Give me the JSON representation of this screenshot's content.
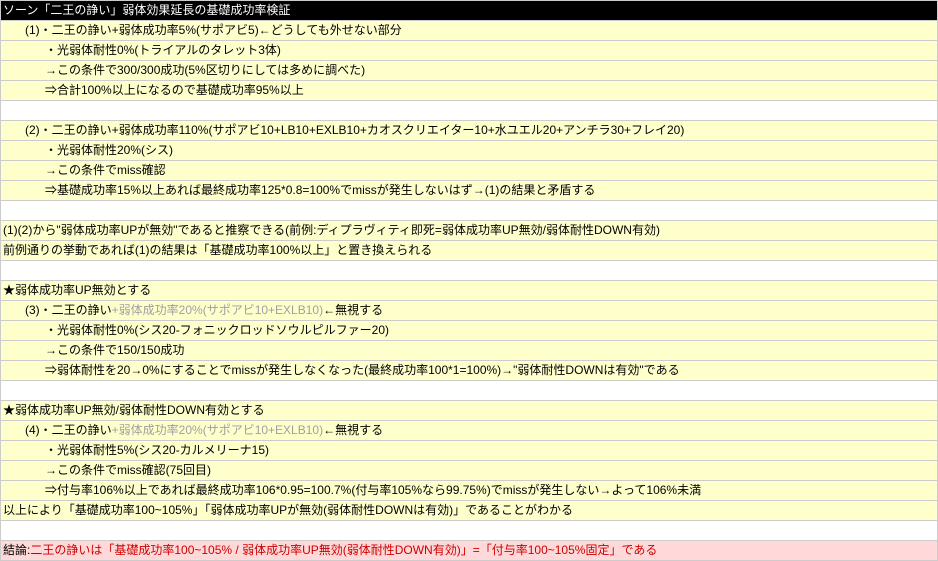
{
  "title": "ソーン「二王の諍い」弱体効果延長の基礎成功率検証",
  "rows": [
    {
      "cls": "yellow-row",
      "ind": "ind1",
      "parts": [
        [
          "(1)・二王の諍い+弱体成功率5%(サポアビ5)←どうしても外せない部分",
          ""
        ]
      ]
    },
    {
      "cls": "yellow-row",
      "ind": "ind2",
      "parts": [
        [
          "・光弱体耐性0%(トライアルのタレット3体)",
          ""
        ]
      ]
    },
    {
      "cls": "yellow-row",
      "ind": "ind2",
      "parts": [
        [
          "→この条件で300/300成功(5%区切りにしては多めに調べた)",
          ""
        ]
      ]
    },
    {
      "cls": "yellow-row",
      "ind": "ind2",
      "parts": [
        [
          "⇒合計100%以上になるので基礎成功率95%以上",
          ""
        ]
      ]
    },
    {
      "cls": "white-row",
      "ind": "",
      "parts": [
        [
          "",
          ""
        ]
      ]
    },
    {
      "cls": "yellow-row",
      "ind": "ind1",
      "parts": [
        [
          "(2)・二王の諍い+弱体成功率110%(サポアビ10+LB10+EXLB10+カオスクリエイター10+水ユエル20+アンチラ30+フレイ20)",
          ""
        ]
      ]
    },
    {
      "cls": "yellow-row",
      "ind": "ind2",
      "parts": [
        [
          "・光弱体耐性20%(シス)",
          ""
        ]
      ]
    },
    {
      "cls": "yellow-row",
      "ind": "ind2",
      "parts": [
        [
          "→この条件でmiss確認",
          ""
        ]
      ]
    },
    {
      "cls": "yellow-row",
      "ind": "ind2",
      "parts": [
        [
          "⇒基礎成功率15%以上あれば最終成功率125*0.8=100%でmissが発生しないはず→(1)の結果と矛盾する",
          ""
        ]
      ]
    },
    {
      "cls": "white-row",
      "ind": "",
      "parts": [
        [
          "",
          ""
        ]
      ]
    },
    {
      "cls": "yellow-row",
      "ind": "",
      "parts": [
        [
          "(1)(2)から\"弱体成功率UPが無効\"であると推察できる(前例:ディプラヴィティ即死=弱体成功率UP無効/弱体耐性DOWN有効)",
          ""
        ]
      ]
    },
    {
      "cls": "yellow-row",
      "ind": "",
      "parts": [
        [
          "前例通りの挙動であれば(1)の結果は「基礎成功率100%以上」と置き換えられる",
          ""
        ]
      ]
    },
    {
      "cls": "white-row",
      "ind": "",
      "parts": [
        [
          "",
          ""
        ]
      ]
    },
    {
      "cls": "yellow-row",
      "ind": "",
      "parts": [
        [
          "★弱体成功率UP無効とする",
          ""
        ]
      ]
    },
    {
      "cls": "yellow-row",
      "ind": "ind1",
      "parts": [
        [
          "(3)・二王の諍い",
          ""
        ],
        [
          "+弱体成功率20%(サポアビ10+EXLB10)",
          "gray"
        ],
        [
          "←無視する",
          ""
        ]
      ]
    },
    {
      "cls": "yellow-row",
      "ind": "ind2",
      "parts": [
        [
          "・光弱体耐性0%(シス20-フォニックロッドソウルピルファー20)",
          ""
        ]
      ]
    },
    {
      "cls": "yellow-row",
      "ind": "ind2",
      "parts": [
        [
          "→この条件で150/150成功",
          ""
        ]
      ]
    },
    {
      "cls": "yellow-row",
      "ind": "ind2",
      "parts": [
        [
          "⇒弱体耐性を20→0%にすることでmissが発生しなくなった(最終成功率100*1=100%)→\"弱体耐性DOWNは有効\"である",
          ""
        ]
      ]
    },
    {
      "cls": "white-row",
      "ind": "",
      "parts": [
        [
          "",
          ""
        ]
      ]
    },
    {
      "cls": "yellow-row",
      "ind": "",
      "parts": [
        [
          "★弱体成功率UP無効/弱体耐性DOWN有効とする",
          ""
        ]
      ]
    },
    {
      "cls": "yellow-row",
      "ind": "ind1",
      "parts": [
        [
          "(4)・二王の諍い",
          ""
        ],
        [
          "+弱体成功率20%(サポアビ10+EXLB10)",
          "gray"
        ],
        [
          "←無視する",
          ""
        ]
      ]
    },
    {
      "cls": "yellow-row",
      "ind": "ind2",
      "parts": [
        [
          "・光弱体耐性5%(シス20-カルメリーナ15)",
          ""
        ]
      ]
    },
    {
      "cls": "yellow-row",
      "ind": "ind2",
      "parts": [
        [
          "→この条件でmiss確認(75回目)",
          ""
        ]
      ]
    },
    {
      "cls": "yellow-row",
      "ind": "ind2",
      "parts": [
        [
          "⇒付与率106%以上であれば最終成功率106*0.95=100.7%(付与率105%なら99.75%)でmissが発生しない→よって106%未満",
          ""
        ]
      ]
    },
    {
      "cls": "yellow-row",
      "ind": "",
      "parts": [
        [
          "以上により「基礎成功率100~105%」「弱体成功率UPが無効(弱体耐性DOWNは有効)」であることがわかる",
          ""
        ]
      ]
    },
    {
      "cls": "white-row",
      "ind": "",
      "parts": [
        [
          "",
          ""
        ]
      ]
    },
    {
      "cls": "pink-row",
      "ind": "",
      "parts": [
        [
          "結論:",
          ""
        ],
        [
          "二王の諍いは「基礎成功率100~105% / 弱体成功率UP無効(弱体耐性DOWN有効)」=「付与率100~105%固定」である",
          "red"
        ]
      ]
    }
  ]
}
